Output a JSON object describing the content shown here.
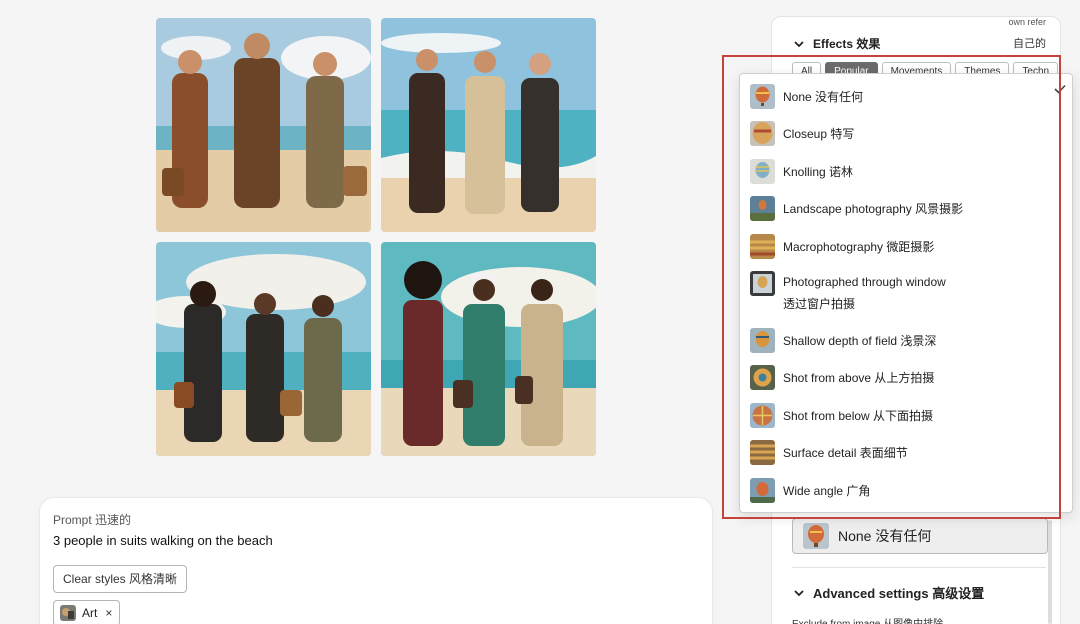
{
  "prompt": {
    "label": "Prompt 迅速的",
    "text": "3 people in suits walking on the beach",
    "clear_label": "Clear styles 风格清晰",
    "chip_label": "Art",
    "chip_close": "×"
  },
  "panel": {
    "top_cut_text": "own refer",
    "top_cn_text": "自己的",
    "effects_title": "Effects 效果",
    "tabs": [
      {
        "label": "All",
        "active": false
      },
      {
        "label": "Popular",
        "active": true
      },
      {
        "label": "Movements",
        "active": false
      },
      {
        "label": "Themes",
        "active": false
      },
      {
        "label": "Techn",
        "active": false
      }
    ],
    "selected_effect": "None 没有任何",
    "advanced_title": "Advanced settings 高级设置",
    "exclude_label": "Exclude from image 从图像中排除"
  },
  "dropdown": {
    "items": [
      {
        "label": "None 没有任何",
        "selected": true
      },
      {
        "label": "Closeup 特写"
      },
      {
        "label": "Knolling 诺林"
      },
      {
        "label": "Landscape photography 风景摄影"
      },
      {
        "label": "Macrophotography 微距摄影"
      },
      {
        "label": "Photographed through window",
        "label_line2": "透过窗户拍摄"
      },
      {
        "label": "Shallow depth of field 浅景深"
      },
      {
        "label": "Shot from above 从上方拍摄"
      },
      {
        "label": "Shot from below 从下面拍摄"
      },
      {
        "label": "Surface detail 表面细节"
      },
      {
        "label": "Wide angle 广角"
      }
    ]
  },
  "colors": {
    "highlight": "#c4443b",
    "active_tab": "#6b6b6b",
    "sky": "#9fc8e0",
    "sea": "#5fb7c4",
    "sand": "#e7d3b4"
  },
  "images": [
    {
      "name": "generated-image-1"
    },
    {
      "name": "generated-image-2"
    },
    {
      "name": "generated-image-3"
    },
    {
      "name": "generated-image-4"
    }
  ]
}
